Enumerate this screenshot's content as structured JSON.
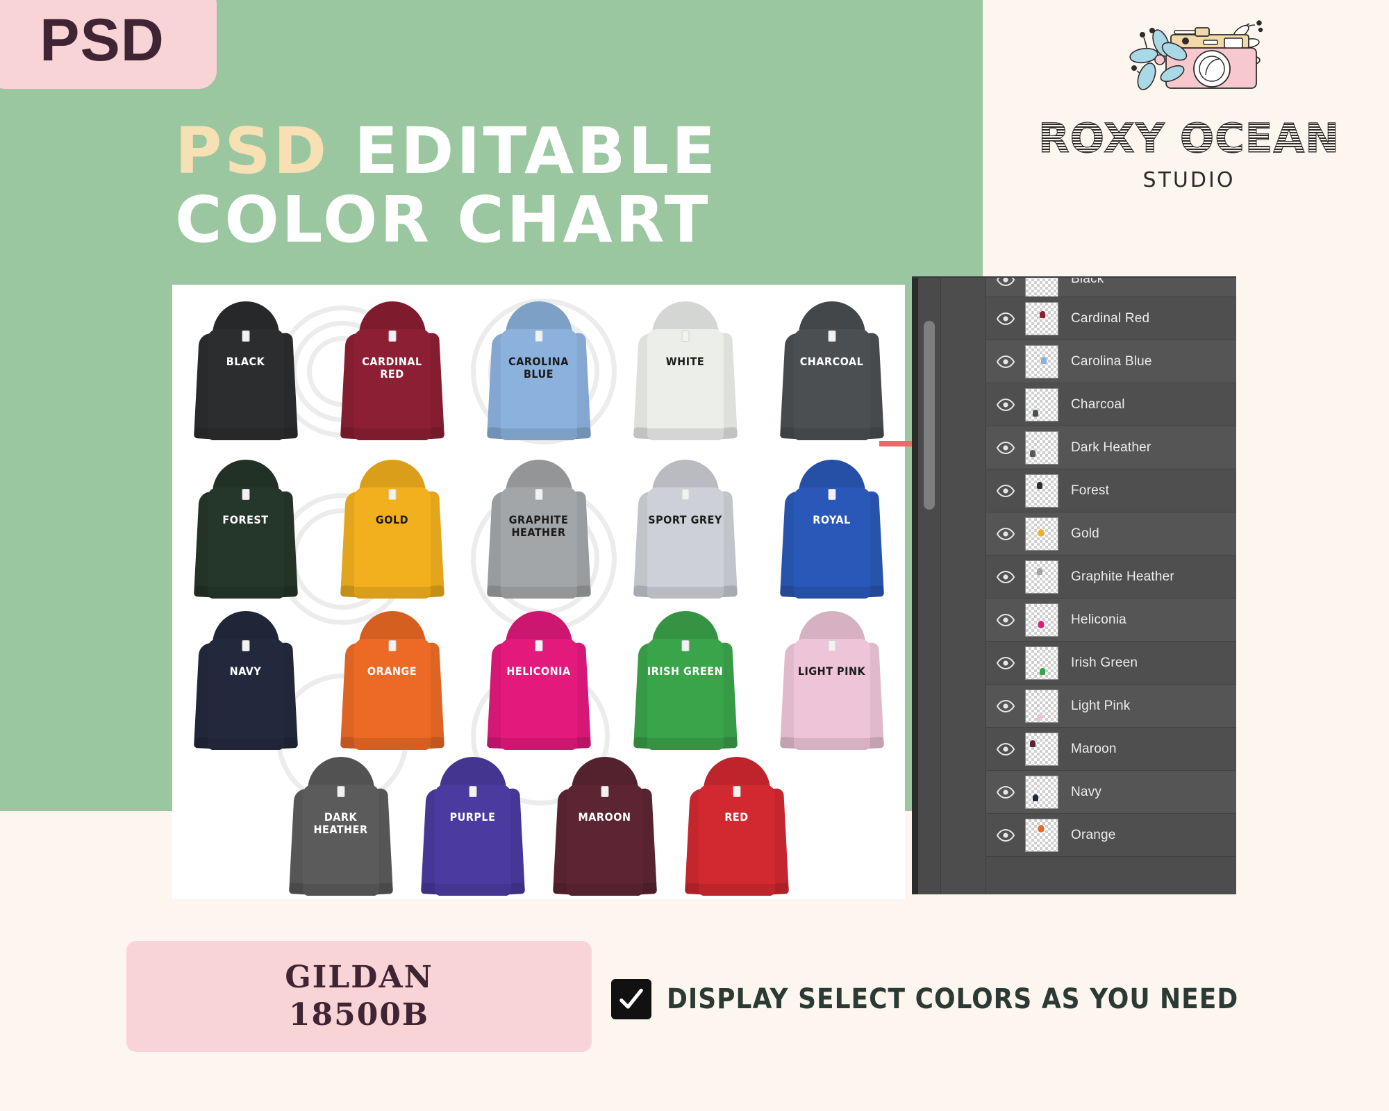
{
  "badge": {
    "label": "PSD"
  },
  "headline": {
    "psd_word": "PSD",
    "line1_rest": "EDITABLE",
    "line2": "COLOR CHART"
  },
  "logo": {
    "name": "ROXY OCEAN",
    "subtitle": "STUDIO",
    "mark": "camera-flower-icon"
  },
  "theme": {
    "green": "#9ac79f",
    "cream": "#fdf6ef",
    "pink": "#f9d4d6",
    "dark_plum": "#3f2533",
    "accent_tan": "#f6e0b4",
    "arrow_red": "#f4646a",
    "panel_gray": "#4d4d4d"
  },
  "product": {
    "brand": "GILDAN",
    "style_number": "18500B"
  },
  "display_note": {
    "checkbox_state": "checked",
    "text": "DISPLAY SELECT COLORS AS YOU NEED"
  },
  "chart_data": {
    "type": "table",
    "title": "PSD EDITABLE COLOR CHART",
    "product": "GILDAN 18500B",
    "rows": [
      [
        {
          "name": "BLACK",
          "hex": "#2b2d2f"
        },
        {
          "name": "CARDINAL RED",
          "hex": "#8c1f33"
        },
        {
          "name": "CAROLINA BLUE",
          "hex": "#8bb2dd"
        },
        {
          "name": "WHITE",
          "hex": "#eceeea"
        },
        {
          "name": "CHARCOAL",
          "hex": "#4c4f52"
        }
      ],
      [
        {
          "name": "FOREST",
          "hex": "#25362a"
        },
        {
          "name": "GOLD",
          "hex": "#f2b01e"
        },
        {
          "name": "GRAPHITE HEATHER",
          "hex": "#a3a6a8"
        },
        {
          "name": "SPORT GREY",
          "hex": "#cdd0d6"
        },
        {
          "name": "ROYAL",
          "hex": "#2a58b8"
        }
      ],
      [
        {
          "name": "NAVY",
          "hex": "#23293d"
        },
        {
          "name": "ORANGE",
          "hex": "#ec6a25"
        },
        {
          "name": "HELICONIA",
          "hex": "#e3197c"
        },
        {
          "name": "IRISH GREEN",
          "hex": "#3aa44a"
        },
        {
          "name": "LIGHT PINK",
          "hex": "#eec5d8"
        }
      ],
      [
        {
          "name": "DARK HEATHER",
          "hex": "#5c5b5c"
        },
        {
          "name": "PURPLE",
          "hex": "#4b3ba0"
        },
        {
          "name": "MAROON",
          "hex": "#5d2533"
        },
        {
          "name": "RED",
          "hex": "#d22830"
        }
      ]
    ]
  },
  "layers_panel": {
    "clipped_top_layer": {
      "name": "Black",
      "hex": "#2b2d2f",
      "visible": true
    },
    "layers": [
      {
        "name": "Cardinal Red",
        "hex": "#8c1f33",
        "visible": true
      },
      {
        "name": "Carolina Blue",
        "hex": "#8bb2dd",
        "visible": true
      },
      {
        "name": "Charcoal",
        "hex": "#4c4f52",
        "visible": true
      },
      {
        "name": "Dark Heather",
        "hex": "#5c5b5c",
        "visible": true
      },
      {
        "name": "Forest",
        "hex": "#25362a",
        "visible": true
      },
      {
        "name": "Gold",
        "hex": "#f2b01e",
        "visible": true
      },
      {
        "name": "Graphite Heather",
        "hex": "#a3a6a8",
        "visible": true
      },
      {
        "name": "Heliconia",
        "hex": "#e3197c",
        "visible": true
      },
      {
        "name": "Irish Green",
        "hex": "#3aa44a",
        "visible": true
      },
      {
        "name": "Light Pink",
        "hex": "#eec5d8",
        "visible": true
      },
      {
        "name": "Maroon",
        "hex": "#5d2533",
        "visible": true
      },
      {
        "name": "Navy",
        "hex": "#23293d",
        "visible": true
      },
      {
        "name": "Orange",
        "hex": "#ec6a25",
        "visible": true
      }
    ]
  },
  "annotation": {
    "arrow": "right-arrow-pointer"
  },
  "watermark": {
    "text": "ROXY OCEAN"
  }
}
